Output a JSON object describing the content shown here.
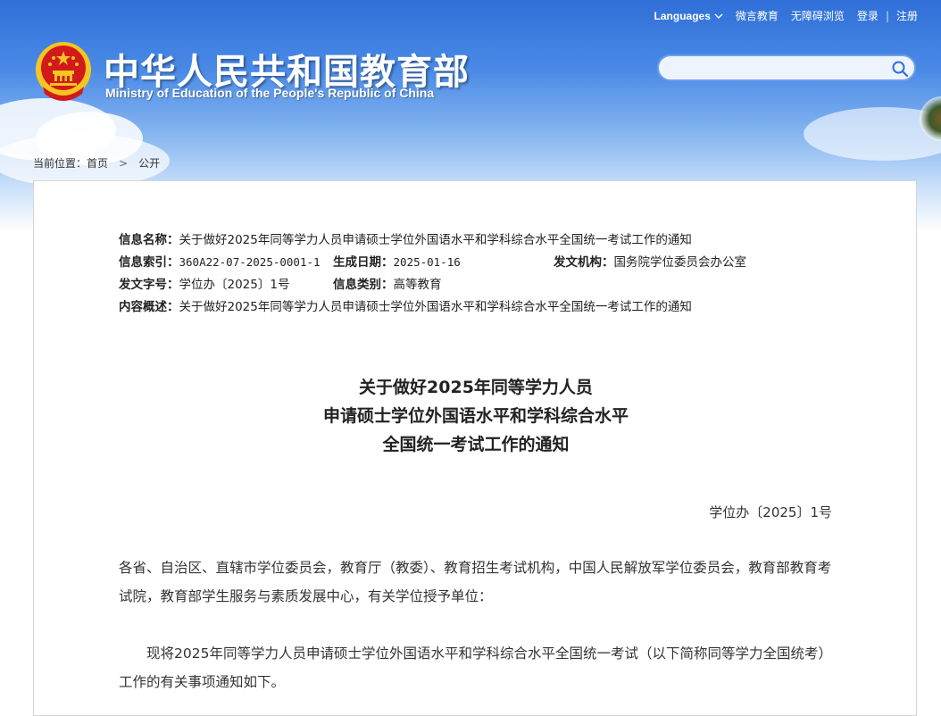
{
  "header": {
    "site_title_cn": "中华人民共和国教育部",
    "site_title_en": "Ministry of Education of the People's Republic of China",
    "nav": {
      "languages": "Languages",
      "weiyan": "微言教育",
      "accessible": "无障碍浏览",
      "login": "登录",
      "divider": "|",
      "register": "注册"
    },
    "search": {
      "placeholder": "",
      "value": ""
    }
  },
  "breadcrumb": {
    "prefix": "当前位置：",
    "home": "首页",
    "separator": ">",
    "current": "公开"
  },
  "info": {
    "name_label": "信息名称：",
    "name_value": "关于做好2025年同等学力人员申请硕士学位外国语水平和学科综合水平全国统一考试工作的通知",
    "index_label": "信息索引：",
    "index_value": "360A22-07-2025-0001-1",
    "date_label": "生成日期：",
    "date_value": "2025-01-16",
    "issuer_label": "发文机构：",
    "issuer_value": "国务院学位委员会办公室",
    "docno_label": "发文字号：",
    "docno_value": "学位办〔2025〕1号",
    "category_label": "信息类别：",
    "category_value": "高等教育",
    "summary_label": "内容概述：",
    "summary_value": "关于做好2025年同等学力人员申请硕士学位外国语水平和学科综合水平全国统一考试工作的通知"
  },
  "article": {
    "title_line1": "关于做好2025年同等学力人员",
    "title_line2": "申请硕士学位外国语水平和学科综合水平",
    "title_line3": "全国统一考试工作的通知",
    "doc_number": "学位办〔2025〕1号",
    "recipients": "各省、自治区、直辖市学位委员会，教育厅（教委）、教育招生考试机构，中国人民解放军学位委员会，教育部教育考试院，教育部学生服务与素质发展中心，有关学位授予单位：",
    "intro": "现将2025年同等学力人员申请硕士学位外国语水平和学科综合水平全国统一考试（以下简称同等学力全国统考）工作的有关事项通知如下。"
  },
  "colors": {
    "header_blue": "#2f6fd8",
    "emblem_red": "#d21a1a",
    "emblem_gold": "#f6c521"
  }
}
